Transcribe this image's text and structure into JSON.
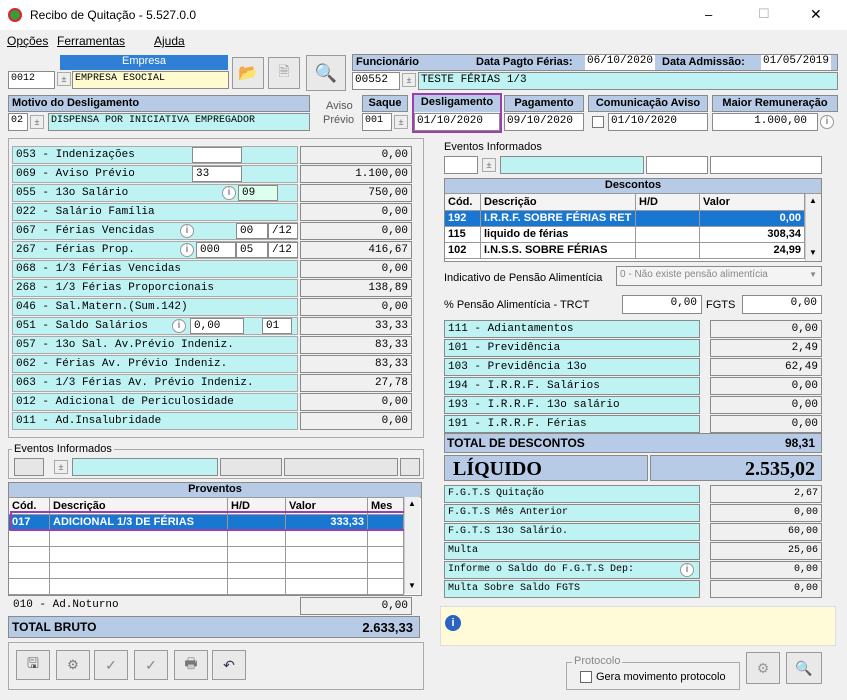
{
  "window": {
    "title": "Recibo de Quitação - 5.527.0.0",
    "min": "–",
    "max": "☐",
    "close": "✕"
  },
  "menu": [
    "Opções",
    "Ferramentas",
    "Ajuda"
  ],
  "empresa": {
    "label": "Empresa",
    "code": "0012",
    "name": "EMPRESA ESOCIAL"
  },
  "funcionario": {
    "label": "Funcionário",
    "code": "00552",
    "name": "TESTE FÉRIAS 1/3"
  },
  "dataPagtoFerias": {
    "label": "Data Pagto Férias:",
    "value": "06/10/2020"
  },
  "dataAdmissao": {
    "label": "Data Admissão:",
    "value": "01/05/2019"
  },
  "motivo": {
    "label": "Motivo do Desligamento",
    "code": "02",
    "value": "DISPENSA POR INICIATIVA EMPREGADOR"
  },
  "avisoPrevio": {
    "l1": "Aviso",
    "l2": "Prévio"
  },
  "saque": {
    "label": "Saque",
    "value": "001"
  },
  "desligamento": {
    "label": "Desligamento",
    "value": "01/10/2020"
  },
  "pagamento": {
    "label": "Pagamento",
    "value": "09/10/2020"
  },
  "comunicacaoAviso": {
    "label": "Comunicação Aviso",
    "value": "01/10/2020"
  },
  "maiorRemuneracao": {
    "label": "Maior Remuneração",
    "value": "1.000,00"
  },
  "leftRows": [
    {
      "label": "053 - Indenizações",
      "value": "0,00"
    },
    {
      "label": "069 - Aviso Prévio",
      "extra": "33",
      "value": "1.100,00"
    },
    {
      "label": "055 - 13o Salário",
      "extra": "09",
      "value": "750,00"
    },
    {
      "label": "022 - Salário Família",
      "value": "0,00"
    },
    {
      "label": "067 - Férias Vencidas",
      "a": "00",
      "b": "/12",
      "value": "0,00"
    },
    {
      "label": "267 - Férias Prop.",
      "c": "000",
      "a": "05",
      "b": "/12",
      "value": "416,67"
    },
    {
      "label": "068 - 1/3 Férias Vencidas",
      "value": "0,00"
    },
    {
      "label": "268 - 1/3 Férias Proporcionais",
      "value": "138,89"
    },
    {
      "label": "046 - Sal.Matern.(Sum.142)",
      "value": "0,00"
    },
    {
      "label": "051 - Saldo Salários",
      "a": "0,00",
      "b": "01",
      "value": "33,33"
    },
    {
      "label": "057 - 13o Sal. Av.Prévio Indeniz.",
      "value": "83,33"
    },
    {
      "label": "062 - Férias Av. Prévio Indeniz.",
      "value": "83,33"
    },
    {
      "label": "063 - 1/3 Férias Av. Prévio Indeniz.",
      "value": "27,78"
    },
    {
      "label": "012 - Adicional de Periculosidade",
      "value": "0,00"
    },
    {
      "label": "011 - Ad.Insalubridade",
      "value": "0,00"
    }
  ],
  "eventosLeft": {
    "legend": "Eventos Informados"
  },
  "proventos": {
    "title": "Proventos",
    "cols": [
      "Cód.",
      "Descrição",
      "H/D",
      "Valor",
      "Mes"
    ],
    "rows": [
      {
        "cod": "017",
        "desc": "ADICIONAL 1/3 DE FÉRIAS",
        "hd": "",
        "valor": "333,33",
        "mes": ""
      }
    ]
  },
  "adNoturno": {
    "label": "010 - Ad.Noturno",
    "value": "0,00"
  },
  "totalBruto": {
    "label": "TOTAL BRUTO",
    "value": "2.633,33"
  },
  "eventosRight": {
    "legend": "Eventos Informados"
  },
  "descontos": {
    "title": "Descontos",
    "cols": [
      "Cód.",
      "Descrição",
      "H/D",
      "Valor"
    ],
    "rows": [
      {
        "cod": "192",
        "desc": "I.R.R.F. SOBRE FÉRIAS RET",
        "hd": "",
        "valor": "0,00"
      },
      {
        "cod": "115",
        "desc": "liquido de férias",
        "hd": "",
        "valor": "308,34"
      },
      {
        "cod": "102",
        "desc": "I.N.S.S. SOBRE FÉRIAS",
        "hd": "",
        "valor": "24,99"
      }
    ]
  },
  "pensao": {
    "label": "Indicativo de Pensão Alimentícia",
    "value": "0 - Não existe pensão alimentícia"
  },
  "pctPensao": {
    "label": "% Pensão Alimentícia - TRCT",
    "value": "0,00"
  },
  "fgts": {
    "label": "FGTS",
    "value": "0,00"
  },
  "rightRows": [
    {
      "label": "111 - Adiantamentos",
      "value": "0,00"
    },
    {
      "label": "101 - Previdência",
      "value": "2,49"
    },
    {
      "label": "103 - Previdência 13o",
      "value": "62,49"
    },
    {
      "label": "194 - I.R.R.F. Salários",
      "value": "0,00"
    },
    {
      "label": "193 - I.R.R.F. 13o salário",
      "value": "0,00"
    },
    {
      "label": "191 - I.R.R.F. Férias",
      "value": "0,00"
    }
  ],
  "totalDescontos": {
    "label": "TOTAL DE DESCONTOS",
    "value": "98,31"
  },
  "liquido": {
    "label": "LÍQUIDO",
    "value": "2.535,02"
  },
  "fgtsRows": [
    {
      "label": "F.G.T.S  Quitação",
      "value": "2,67"
    },
    {
      "label": "F.G.T.S  Mês Anterior",
      "value": "0,00"
    },
    {
      "label": "F.G.T.S  13o Salário.",
      "value": "60,00"
    },
    {
      "label": "Multa",
      "value": "25,06"
    },
    {
      "label": "Informe o Saldo do F.G.T.S Dep:",
      "value": "0,00"
    },
    {
      "label": "Multa Sobre Saldo FGTS",
      "value": "0,00"
    }
  ],
  "protocolo": {
    "legend": "Protocolo",
    "checkbox": "Gera movimento protocolo"
  }
}
